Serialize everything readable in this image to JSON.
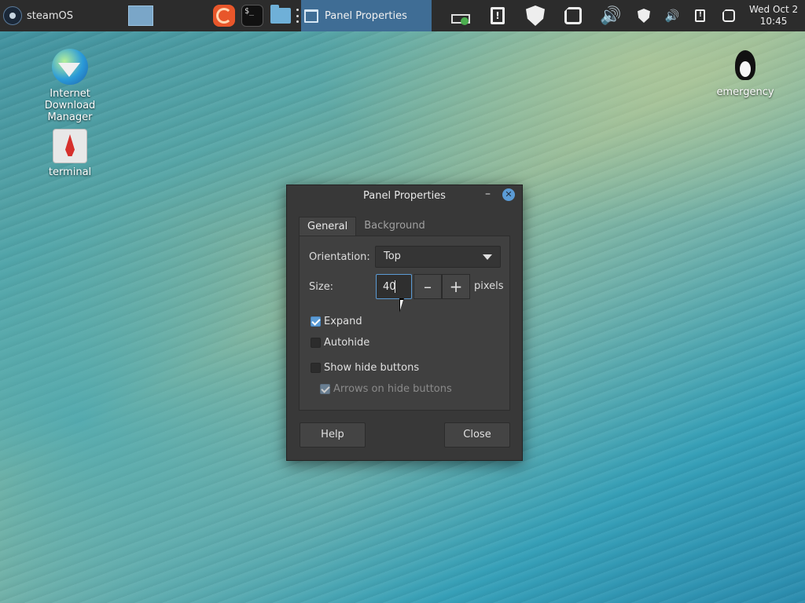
{
  "taskbar": {
    "start_label": "steamOS",
    "active_task": "Panel Properties",
    "clock_line1": "Wed Oct  2",
    "clock_line2": "10:45",
    "term_glyph": "$_"
  },
  "desktop": {
    "icons": [
      {
        "label": "Internet Download Manager",
        "icon": "idm-icon"
      },
      {
        "label": "terminal",
        "icon": "terminal-icon"
      },
      {
        "label": "emergency",
        "icon": "tux-icon"
      }
    ]
  },
  "dialog": {
    "title": "Panel Properties",
    "tabs": [
      "General",
      "Background"
    ],
    "active_tab": "General",
    "orientation_label": "Orientation:",
    "orientation_value": "Top",
    "size_label": "Size:",
    "size_value": "40",
    "size_unit": "pixels",
    "checkboxes": [
      {
        "label": "Expand",
        "checked": true,
        "enabled": true
      },
      {
        "label": "Autohide",
        "checked": false,
        "enabled": true
      },
      {
        "label": "Show hide buttons",
        "checked": false,
        "enabled": true
      },
      {
        "label": "Arrows on hide buttons",
        "checked": true,
        "enabled": false
      }
    ],
    "help_label": "Help",
    "close_label": "Close"
  },
  "colors": {
    "taskbar_bg": "#2c2c2c",
    "active_task_bg": "#3f6d95",
    "accent": "#5b9bd5",
    "dialog_bg": "#383838"
  }
}
